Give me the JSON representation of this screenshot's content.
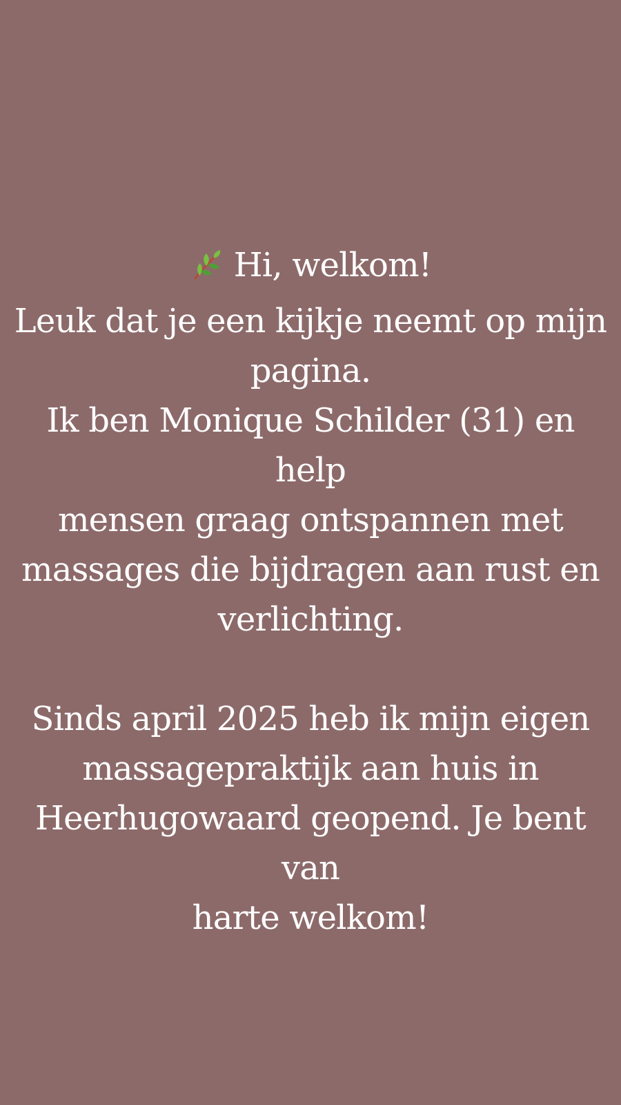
{
  "intro": {
    "greeting_text": "Hi, welkom!",
    "line_1": "Leuk dat je een kijkje neemt op mijn",
    "line_2": "pagina.",
    "line_3": "Ik ben Monique Schilder (31) en help",
    "line_4": "mensen graag ontspannen met",
    "line_5": "massages die bijdragen aan rust en",
    "line_6": "verlichting."
  },
  "details": {
    "line_1": "Sinds april 2025 heb ik mijn eigen",
    "line_2": "massagepraktijk aan huis in",
    "line_3": "Heerhugowaard geopend. Je bent van",
    "line_4": "harte welkom!"
  },
  "icons": {
    "greeting_icon": "herb-branch-icon"
  },
  "colors": {
    "background": "#8d6a6a",
    "text": "#ffffff",
    "leaf_green": "#7ac043",
    "leaf_dark": "#4f9f36",
    "stem": "#b54a35"
  }
}
